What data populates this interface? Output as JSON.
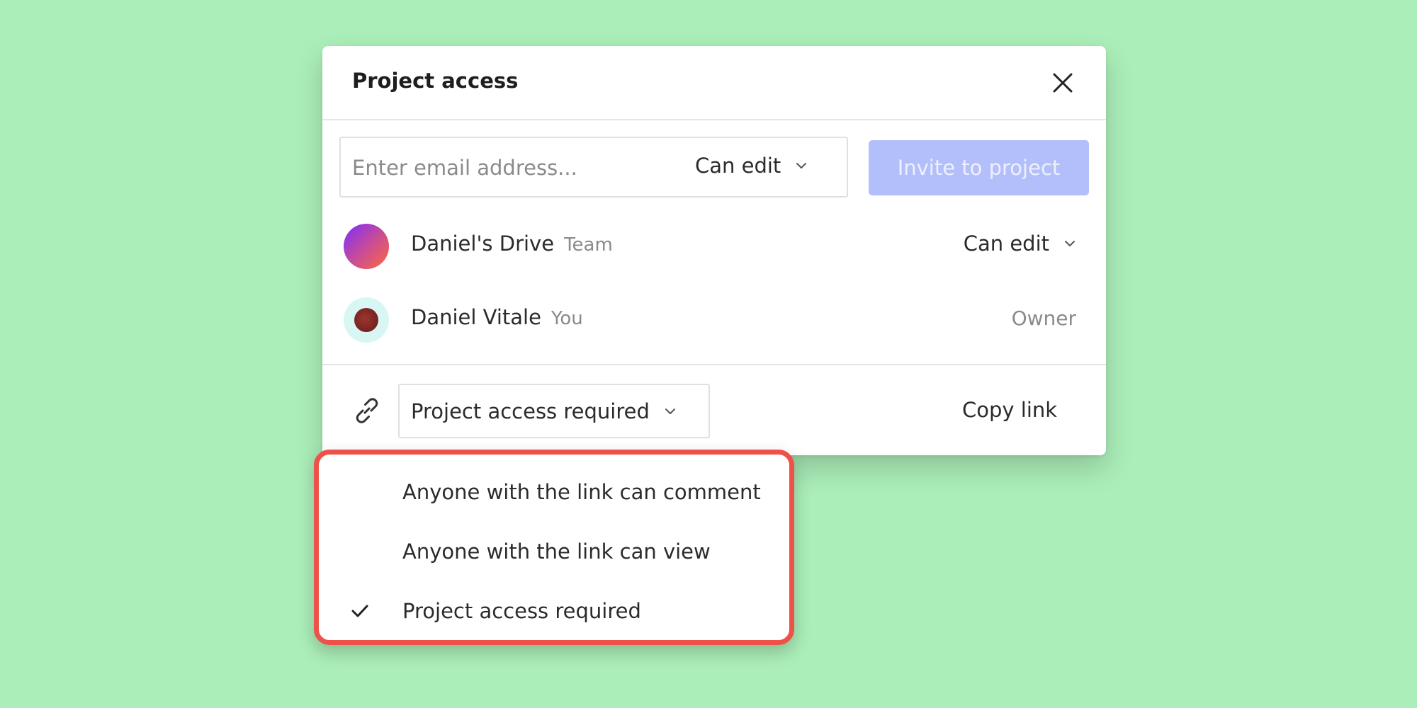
{
  "modal": {
    "title": "Project access",
    "invite": {
      "email_placeholder": "Enter email address...",
      "email_value": "",
      "permission": "Can edit",
      "invite_button": "Invite to project"
    },
    "members": [
      {
        "name": "Daniel's Drive",
        "tag": "Team",
        "role": "Can edit",
        "avatar": "team-gradient-avatar"
      },
      {
        "name": "Daniel Vitale",
        "tag": "You",
        "role": "Owner",
        "avatar": "user-photo-avatar"
      }
    ],
    "link": {
      "access": "Project access required",
      "copy_link": "Copy link"
    }
  },
  "dropdown": {
    "options": [
      {
        "label": "Anyone with the link can comment",
        "selected": false
      },
      {
        "label": "Anyone with the link can view",
        "selected": false
      },
      {
        "label": "Project access required",
        "selected": true
      }
    ]
  },
  "icons": {
    "close": "close-icon",
    "chevron": "chevron-down-icon",
    "link": "link-icon",
    "check": "check-icon"
  },
  "colors": {
    "background": "#abeeb9",
    "invite_button": "#b3bffb",
    "highlight_border": "#ee5148"
  }
}
